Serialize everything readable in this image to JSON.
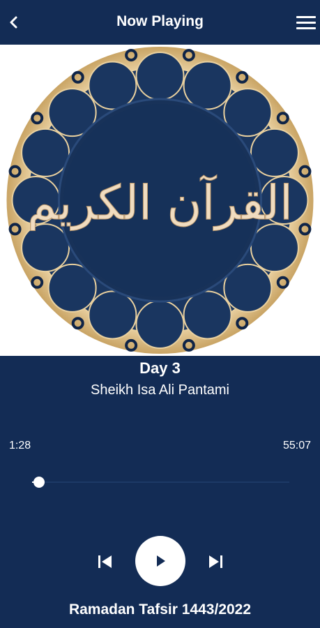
{
  "header": {
    "title": "Now Playing"
  },
  "artwork": {
    "calligraphy": "القرآن الكريم",
    "gold": "#e7c48c",
    "navy": "#163159"
  },
  "track": {
    "title": "Day 3",
    "artist": "Sheikh Isa Ali Pantami"
  },
  "player": {
    "current_time": "1:28",
    "duration": "55:07",
    "progress": 0.027
  },
  "footer": {
    "album": "Ramadan Tafsir 1443/2022"
  },
  "colors": {
    "background": "#132c55",
    "accent": "#ffffff"
  }
}
